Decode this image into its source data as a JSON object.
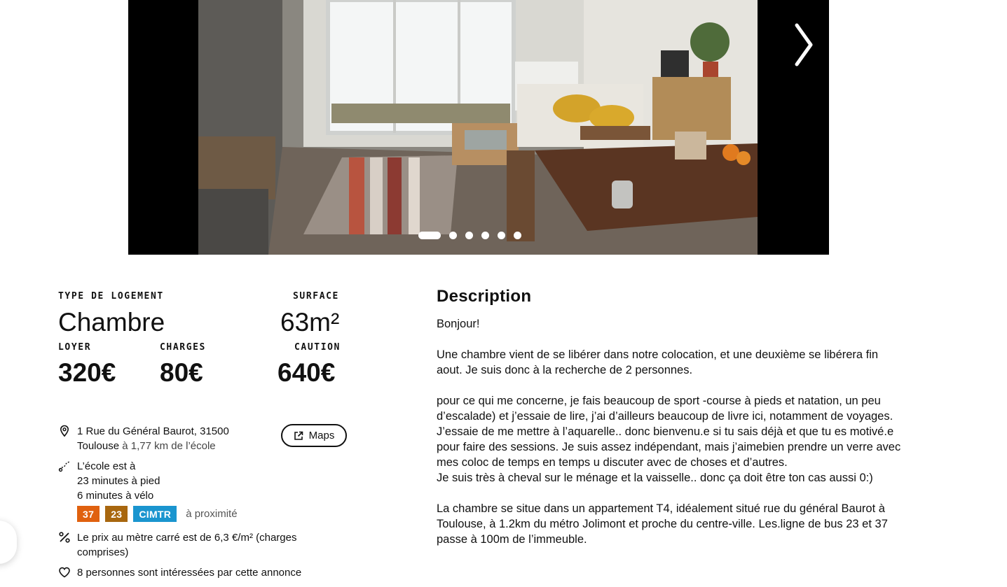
{
  "carousel": {
    "image_alt": "",
    "next_label": "",
    "slide_count": 6,
    "active_slide": 1
  },
  "listing": {
    "type_label": "TYPE DE LOGEMENT",
    "type_value": "Chambre",
    "surface_label": "SURFACE",
    "surface_value": "63m²",
    "rent_label": "LOYER",
    "rent_value": "320€",
    "charges_label": "CHARGES",
    "charges_value": "80€",
    "deposit_label": "CAUTION",
    "deposit_value": "640€"
  },
  "location": {
    "address_line1": "1 Rue du Général Baurot, 31500",
    "address_city": "Toulouse",
    "distance": "à 1,77 km de l’école",
    "maps_label": "Maps"
  },
  "commute": {
    "intro": "L’école est à",
    "walk": "23 minutes à pied",
    "bike": "6 minutes à vélo",
    "lines": [
      {
        "label": "37",
        "color": "#e0610f"
      },
      {
        "label": "23",
        "color": "#a8670f"
      },
      {
        "label": "CIMTR",
        "color": "#1a95cf"
      }
    ],
    "nearby": "à proximité"
  },
  "price_per_m2": "Le prix au mètre carré est de 6,3 €/m² (charges comprises)",
  "interested": "8 personnes sont intéressées par cette annonce",
  "description": {
    "title": "Description",
    "text": "Bonjour!\n\nUne chambre vient de se libérer dans notre colocation, et une deuxième se libérera fin aout. Je suis donc à la recherche de 2 personnes.\n\npour ce qui me concerne, je fais beaucoup de sport -course à pieds et natation, un peu d’escalade) et j’essaie de lire, j’ai d’ailleurs beaucoup de livre ici, notamment de voyages. J’essaie de me mettre à l’aquarelle.. donc bienvenu.e si tu sais déjà et que tu es motivé.e pour faire des sessions. Je suis assez indépendant, mais j’aimebien prendre un verre avec mes coloc de temps en temps u discuter avec de choses et d’autres.\nJe suis très à cheval sur le ménage et la vaisselle.. donc ça doit être ton cas aussi 0:)\n\nLa chambre se situe dans un appartement T4, idéalement situé rue du général Baurot à Toulouse, à 1.2km du métro Jolimont et proche du centre-ville. Les.ligne de bus 23 et 37 passe à 100m de l’immeuble."
  },
  "icons": {
    "next": "chevron-right-icon",
    "location": "map-pin-icon",
    "external": "external-link-icon",
    "walk": "walk-route-icon",
    "percent": "percent-icon",
    "heart": "heart-icon"
  }
}
